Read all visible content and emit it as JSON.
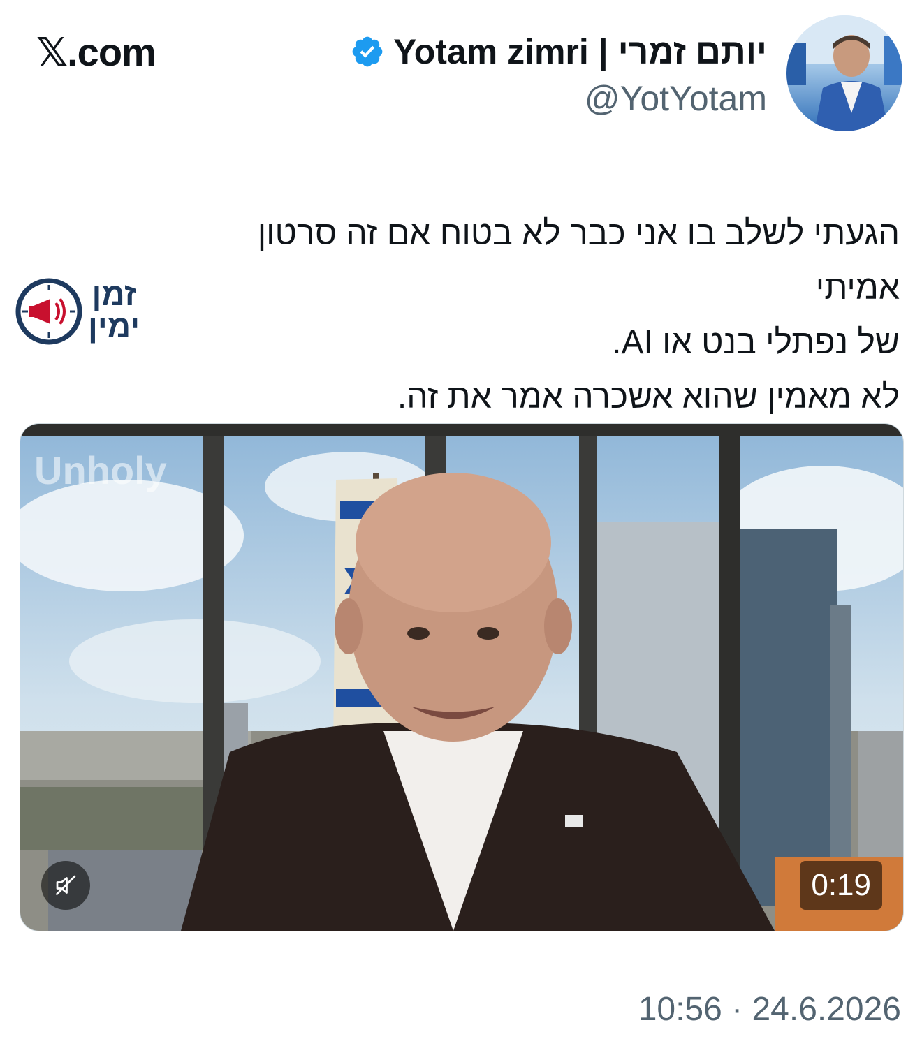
{
  "site": {
    "brand": "𝕏.com"
  },
  "author": {
    "name": "Yotam zimri | יותם זמרי",
    "handle": "@YotYotam",
    "verified": true,
    "verified_color": "#1d9bf0"
  },
  "tweet": {
    "lines": [
      "הגעתי לשלב בו אני כבר לא בטוח אם זה סרטון אמיתי",
      "של נפתלי בנט או AI.",
      "לא מאמין שהוא אשכרה אמר את זה."
    ]
  },
  "watermark": {
    "line1": "זמן",
    "line2": "ימין",
    "color": "#1e3a5f",
    "accent": "#c8102e"
  },
  "media": {
    "type": "video",
    "duration": "0:19",
    "muted": true,
    "mute_icon": "speaker-muted-icon",
    "background_sign": "Unholy"
  },
  "timestamp": "10:56 · 24.6.2026"
}
